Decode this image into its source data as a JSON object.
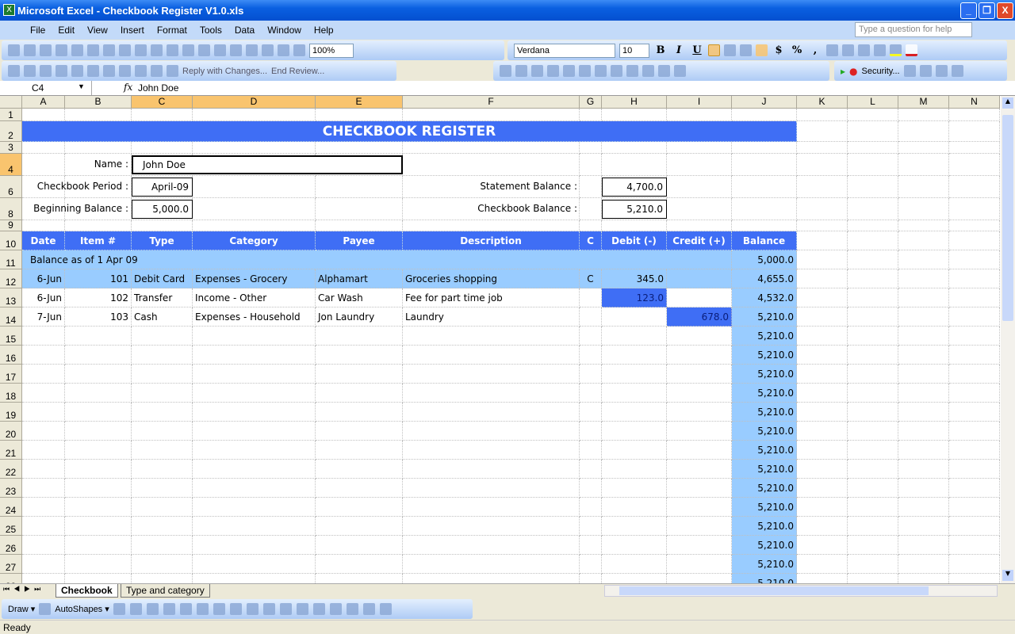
{
  "window": {
    "title": "Microsoft Excel - Checkbook Register V1.0.xls",
    "min": "_",
    "max": "❐",
    "close": "X"
  },
  "menu": [
    "File",
    "Edit",
    "View",
    "Insert",
    "Format",
    "Tools",
    "Data",
    "Window",
    "Help"
  ],
  "help_placeholder": "Type a question for help",
  "toolbar": {
    "zoom": "100%",
    "font": "Verdana",
    "size": "10",
    "bold": "B",
    "italic": "I",
    "underline": "U",
    "currency": "$",
    "percent": "%",
    "comma": ",",
    "reply": "Reply with Changes...",
    "end_review": "End Review...",
    "security": "Security..."
  },
  "standard_icons": [
    "new-icon",
    "open-icon",
    "save-icon",
    "permission-icon",
    "print-icon",
    "print-preview-icon",
    "spelling-icon",
    "research-icon",
    "cut-icon",
    "copy-icon",
    "paste-icon",
    "format-painter-icon",
    "undo-icon",
    "redo-icon",
    "hyperlink-icon",
    "autosum-icon",
    "sort-asc-icon",
    "sort-desc-icon",
    "chart-wizard-icon"
  ],
  "formula": {
    "name_box": "C4",
    "fx": "fx",
    "value": "John Doe"
  },
  "columns": [
    "A",
    "B",
    "C",
    "D",
    "E",
    "F",
    "G",
    "H",
    "I",
    "J",
    "K",
    "L",
    "M",
    "N"
  ],
  "rows": [
    "1",
    "2",
    "3",
    "4",
    "6",
    "8",
    "9",
    "10",
    "11",
    "12",
    "13",
    "14",
    "15",
    "16",
    "17",
    "18",
    "19",
    "20",
    "21",
    "22",
    "23",
    "24",
    "25",
    "26",
    "27",
    "28"
  ],
  "sheet": {
    "title": "CHECKBOOK REGISTER",
    "name_label": "Name :",
    "name": "John Doe",
    "period_label": "Checkbook Period :",
    "period": "April-09",
    "begin_label": "Beginning Balance :",
    "begin": "5,000.0",
    "stmt_label": "Statement Balance :",
    "stmt": "4,700.0",
    "cb_label": "Checkbook Balance :",
    "cb": "5,210.0",
    "headers": [
      "Date",
      "Item #",
      "Type",
      "Category",
      "Payee",
      "Description",
      "C",
      "Debit   (-)",
      "Credit (+)",
      "Balance"
    ],
    "opening": {
      "label": "Balance as of  1 Apr 09",
      "balance": "5,000.0"
    },
    "entries": [
      [
        "6-Jun",
        "101",
        "Debit Card",
        "Expenses - Grocery",
        "Alphamart",
        "Groceries shopping",
        "C",
        "345.0",
        "",
        "4,655.0"
      ],
      [
        "6-Jun",
        "102",
        "Transfer",
        "Income - Other",
        "Car Wash",
        "Fee for part time job",
        "",
        "123.0",
        "",
        "4,532.0"
      ],
      [
        "7-Jun",
        "103",
        "Cash",
        "Expenses - Household",
        "Jon Laundry",
        "Laundry",
        "",
        "",
        "678.0",
        "5,210.0"
      ]
    ],
    "empty_balance": "5,210.0"
  },
  "tabs": [
    "Checkbook",
    "Type and category"
  ],
  "drawbar": {
    "draw": "Draw ▾",
    "autoshapes": "AutoShapes ▾"
  },
  "status": "Ready",
  "colors": {
    "header": "#3f6ef5",
    "light": "#99ccff",
    "selected_header": "#f9c46e"
  }
}
